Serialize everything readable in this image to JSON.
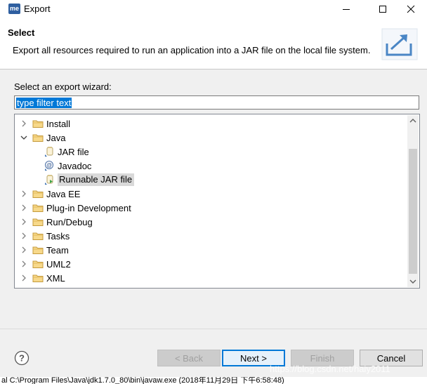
{
  "window": {
    "app_icon_text": "me",
    "title": "Export"
  },
  "header": {
    "title": "Select",
    "description": "Export all resources required to run an application into a JAR file on the local file system."
  },
  "wizard": {
    "label": "Select an export wizard:",
    "filter_value": "type filter text"
  },
  "tree": {
    "items": [
      {
        "label": "Install",
        "level": 0,
        "expanded": false,
        "icon": "folder-icon"
      },
      {
        "label": "Java",
        "level": 0,
        "expanded": true,
        "icon": "folder-icon"
      },
      {
        "label": "JAR file",
        "level": 1,
        "icon": "jar-icon"
      },
      {
        "label": "Javadoc",
        "level": 1,
        "icon": "javadoc-icon"
      },
      {
        "label": "Runnable JAR file",
        "level": 1,
        "icon": "runnable-jar-icon",
        "selected": true
      },
      {
        "label": "Java EE",
        "level": 0,
        "expanded": false,
        "icon": "folder-icon"
      },
      {
        "label": "Plug-in Development",
        "level": 0,
        "expanded": false,
        "icon": "folder-icon"
      },
      {
        "label": "Run/Debug",
        "level": 0,
        "expanded": false,
        "icon": "folder-icon"
      },
      {
        "label": "Tasks",
        "level": 0,
        "expanded": false,
        "icon": "folder-icon"
      },
      {
        "label": "Team",
        "level": 0,
        "expanded": false,
        "icon": "folder-icon"
      },
      {
        "label": "UML2",
        "level": 0,
        "expanded": false,
        "icon": "folder-icon"
      },
      {
        "label": "XML",
        "level": 0,
        "expanded": false,
        "icon": "folder-icon"
      }
    ]
  },
  "buttons": {
    "back": "< Back",
    "next": "Next >",
    "finish": "Finish",
    "cancel": "Cancel"
  },
  "watermark": "https://blog.csdn.net/haiy2011",
  "status_text": "al C:\\Program Files\\Java\\jdk1.7.0_80\\bin\\javaw.exe (2018年11月29日 下午6:58:48)"
}
